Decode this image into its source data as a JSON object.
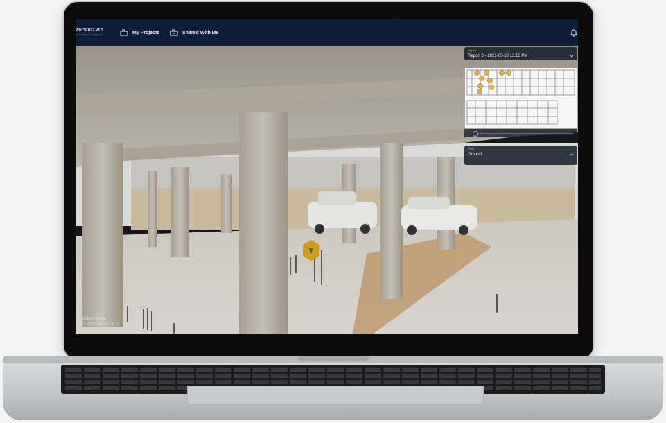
{
  "header": {
    "logo_line1": "WHITEHELMET",
    "logo_line2": "construction intelligence",
    "nav": [
      {
        "label": "My Projects",
        "icon": "folder-icon"
      },
      {
        "label": "Shared With Me",
        "icon": "shared-folder-icon"
      }
    ],
    "notification_icon": "bell-icon"
  },
  "report_panel": {
    "report_label": "Report",
    "report_value": "Report 2 - 2021-05-30 13:15 PM",
    "floor_label": "Floor",
    "floor_value": "Ground"
  },
  "viewer": {
    "watermark_line1": "Labor House",
    "watermark_line2": "© 2021-05-30 13:15"
  },
  "colors": {
    "topbar": "#0f1e38",
    "accent": "#e0b33a",
    "panel": "#141c2a"
  }
}
